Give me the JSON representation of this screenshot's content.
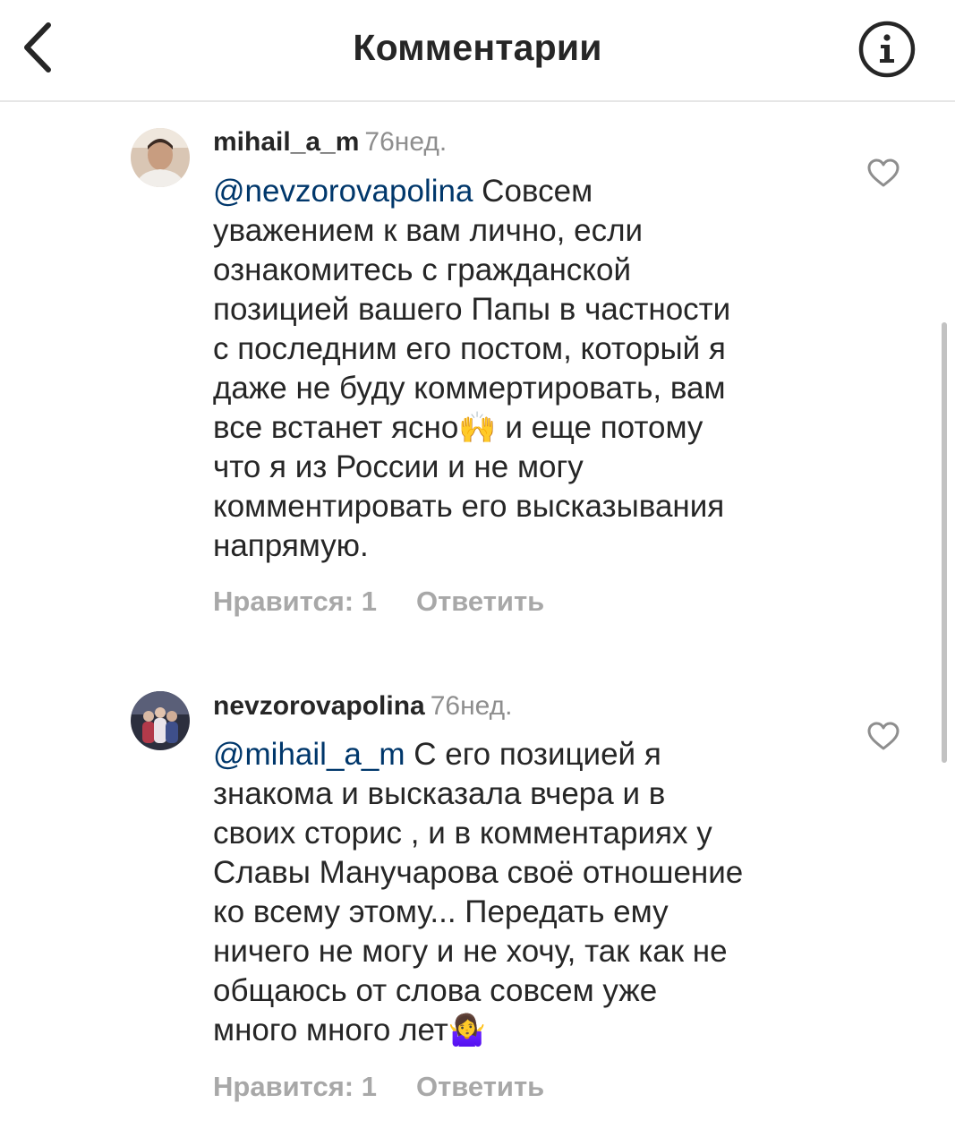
{
  "header": {
    "title": "Комментарии",
    "back_icon": "chevron-left-icon",
    "info_icon": "info-icon"
  },
  "comments": [
    {
      "username": "mihail_a_m",
      "age": "76нед.",
      "mention": "@nevzorovapolina",
      "lines": [
        " Совсем",
        "уважением к вам лично, если",
        "ознакомитесь с гражданской",
        "позицией вашего Папы в частности",
        "с последним его постом, который я",
        "даже не буду коммертировать, вам",
        "все встанет ясно",
        " и еще потому",
        "что я из России и не могу",
        "комментировать его высказывания",
        "напрямую."
      ],
      "emoji": "🙌",
      "likes_label": "Нравится: 1",
      "reply_label": "Ответить"
    },
    {
      "username": "nevzorovapolina",
      "age": "76нед.",
      "mention": "@mihail_a_m",
      "lines": [
        " С его позицией я",
        "знакома и высказала вчера и в",
        "своих сторис , и в комментариях  у",
        "Славы Манучарова своё отношение",
        "ко всему этому... Передать ему",
        "ничего не могу и не хочу, так как не",
        "общаюсь от слова совсем уже",
        "много много лет"
      ],
      "emoji": "🤷‍♀️",
      "likes_label": "Нравится: 1",
      "reply_label": "Ответить"
    }
  ],
  "colors": {
    "text": "#262626",
    "mention": "#00376b",
    "secondary": "#8e8e8e",
    "action": "#a8a8a8",
    "divider": "#e6e6e6"
  }
}
